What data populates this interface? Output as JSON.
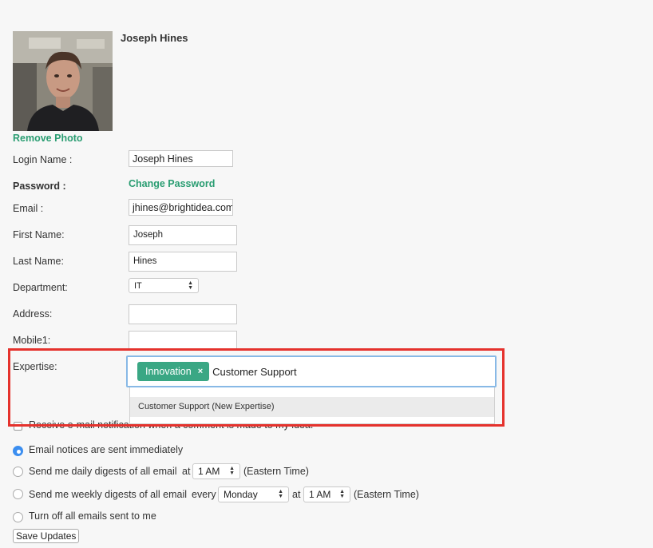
{
  "profile": {
    "name": "Joseph Hines",
    "remove_photo": "Remove Photo"
  },
  "form": {
    "login_label": "Login Name :",
    "login_value": "Joseph Hines",
    "password_label": "Password :",
    "change_password": "Change Password",
    "email_label": "Email :",
    "email_value": "jhines@brightidea.com",
    "first_name_label": "First Name:",
    "first_name_value": "Joseph",
    "last_name_label": "Last Name:",
    "last_name_value": "Hines",
    "department_label": "Department:",
    "department_value": "IT",
    "address_label": "Address:",
    "address_value": "",
    "mobile_label": "Mobile1:",
    "mobile_value": "",
    "expertise_label": "Expertise:",
    "expertise_tag": "Innovation",
    "expertise_tag_remove": "×",
    "expertise_input": "Customer Support",
    "expertise_suggestion": "Customer Support (New Expertise)"
  },
  "notifications": {
    "receive_label": "Receive e-mail notification when a comment is made to my idea.",
    "receive_checked": false,
    "selected_option": "immediately",
    "immediate_label": "Email notices are sent immediately",
    "daily_prefix": "Send me daily digests of all email",
    "daily_at": "at",
    "daily_time": "1 AM",
    "daily_tz": "(Eastern Time)",
    "weekly_prefix": "Send me weekly digests of all email",
    "weekly_every": "every",
    "weekly_day": "Monday",
    "weekly_at": "at",
    "weekly_time": "1 AM",
    "weekly_tz": "(Eastern Time)",
    "off_label": "Turn off all emails sent to me"
  },
  "actions": {
    "save": "Save Updates"
  },
  "colors": {
    "accent_green": "#2a9d72",
    "tag_green": "#3aa784",
    "highlight_red": "#e5322d",
    "focus_blue": "#88b9e6",
    "radio_blue": "#3b8ef0"
  }
}
